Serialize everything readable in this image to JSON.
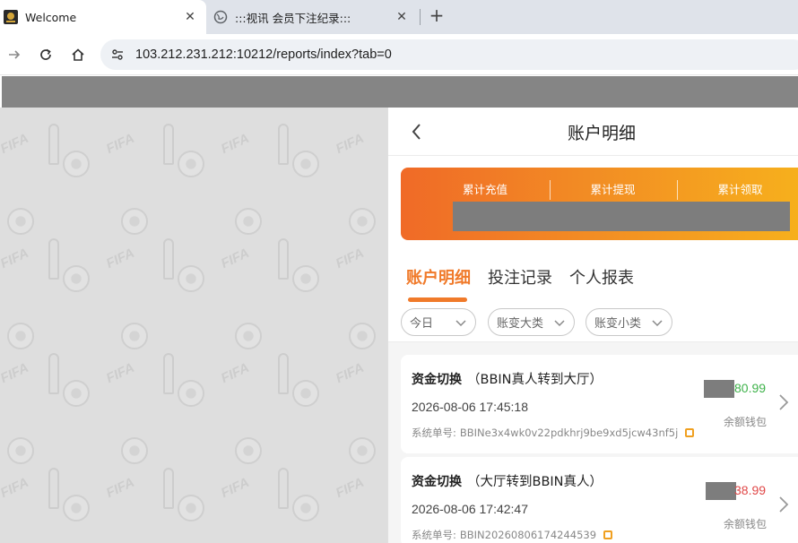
{
  "browser": {
    "tabs": [
      {
        "title": "Welcome",
        "active": true
      },
      {
        "title": ":::视讯 会员下注纪录:::",
        "active": false
      }
    ],
    "url": "103.212.231.212:10212/reports/index?tab=0"
  },
  "panel": {
    "title": "账户明细",
    "summary": {
      "labels": [
        "累计充值",
        "累计提现",
        "累计领取"
      ]
    },
    "tabs": [
      "账户明细",
      "投注记录",
      "个人报表"
    ],
    "active_tab": 0,
    "filters": [
      "今日",
      "账变大类",
      "账变小类"
    ],
    "records": [
      {
        "type": "资金切换",
        "detail": "（BBIN真人转到大厅）",
        "time": "2026-08-06 17:45:18",
        "order_label": "系统单号:",
        "order_id": "BBINe3x4wk0v22pdkhrj9be9xd5jcw43nf5j",
        "amount": "80.99",
        "direction": "in",
        "wallet": "余额钱包"
      },
      {
        "type": "资金切换",
        "detail": "（大厅转到BBIN真人）",
        "time": "2026-08-06 17:42:47",
        "order_label": "系统单号:",
        "order_id": "BBIN20260806174244539",
        "amount": "38.99",
        "direction": "out",
        "wallet": "余额钱包"
      }
    ]
  },
  "colors": {
    "accent": "#f07a2a",
    "positive": "#3eb24a",
    "negative": "#e04848",
    "header_bar": "#858585"
  }
}
